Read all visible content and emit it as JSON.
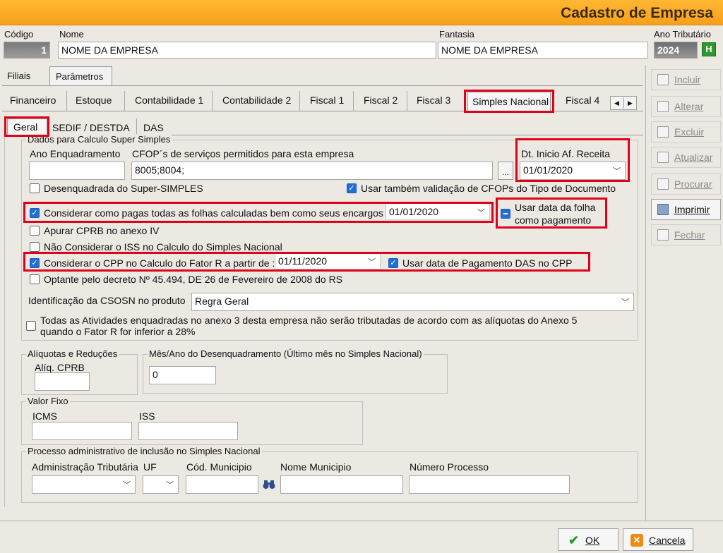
{
  "title": "Cadastro de Empresa",
  "header": {
    "codigo_label": "Código",
    "codigo_value": "1",
    "nome_label": "Nome",
    "nome_value": "NOME DA EMPRESA",
    "fantasia_label": "Fantasia",
    "fantasia_value": "NOME DA EMPRESA",
    "ano_label": "Ano Tributário",
    "ano_value": "2024",
    "ano_badge": "H"
  },
  "top_tabs": [
    "Filiais",
    "Parâmetros"
  ],
  "sub_tabs": [
    "Financeiro",
    "Estoque",
    "Contabilidade 1",
    "Contabilidade 2",
    "Fiscal 1",
    "Fiscal 2",
    "Fiscal 3",
    "Simples Nacional",
    "Fiscal 4"
  ],
  "inner_tabs": [
    "Geral",
    "SEDIF / DESTDA",
    "DAS"
  ],
  "dados": {
    "group_title": "Dados para Calculo Super Simples",
    "ano_enq_label": "Ano Enquadramento",
    "cfop_label": "CFOP´s de serviços permitidos para esta empresa",
    "cfop_value": "8005;8004;",
    "ellipsis": "...",
    "dt_inicio_label": "Dt. Inicio Af. Receita",
    "dt_inicio_value": "01/01/2020",
    "desenquadrada_label": "Desenquadrada do Super-SIMPLES",
    "usar_cfop_label": "Usar também validação de CFOPs do Tipo de Documento",
    "considerar_pagas_label": "Considerar como pagas todas as folhas calculadas bem como seus encargos",
    "considerar_pagas_date": "01/01/2020",
    "usar_data_folha_label_1": "Usar data da folha",
    "usar_data_folha_label_2": "como pagamento",
    "apurar_cprb_label": "Apurar CPRB no anexo IV",
    "nao_iss_label": "Não Considerar o ISS no Calculo do Simples Nacional",
    "cpp_label": "Considerar o CPP no Calculo do Fator R a partir de :",
    "cpp_date": "01/11/2020",
    "usar_das_label": "Usar data de Pagamento DAS no CPP",
    "decreto_label": "Optante pelo decreto  Nº 45.494, DE 26 de Fevereiro de 2008 do RS",
    "csosn_label": "Identificação da CSOSN no produto",
    "csosn_value": "Regra Geral",
    "todas_label_1": "Todas as Atividades enquadradas no anexo 3 desta empresa não serão tributadas de acordo com as alíquotas do Anexo 5",
    "todas_label_2": "quando o Fator R for inferior a 28%"
  },
  "aliquotas": {
    "group_title": "Alíquotas e Reduções",
    "cprb_label": "Alíq. CPRB"
  },
  "mes_ano": {
    "group_title": "Mês/Ano do Desenquadramento (Último mês no Simples Nacional)",
    "value": "0"
  },
  "valor_fixo": {
    "group_title": "Valor Fixo",
    "icms_label": "ICMS",
    "iss_label": "ISS"
  },
  "processo": {
    "group_title": "Processo administrativo de inclusão no Simples Nacional",
    "adm_label": "Administração Tributária",
    "uf_label": "UF",
    "cod_mun_label": "Cód. Municipio",
    "nome_mun_label": "Nome Municipio",
    "num_proc_label": "Número Processo"
  },
  "side_buttons": [
    "Incluir",
    "Alterar",
    "Excluir",
    "Atualizar",
    "Procurar",
    "Imprimir",
    "Fechar"
  ],
  "footer": {
    "ok": "OK",
    "cancel": "Cancela"
  }
}
